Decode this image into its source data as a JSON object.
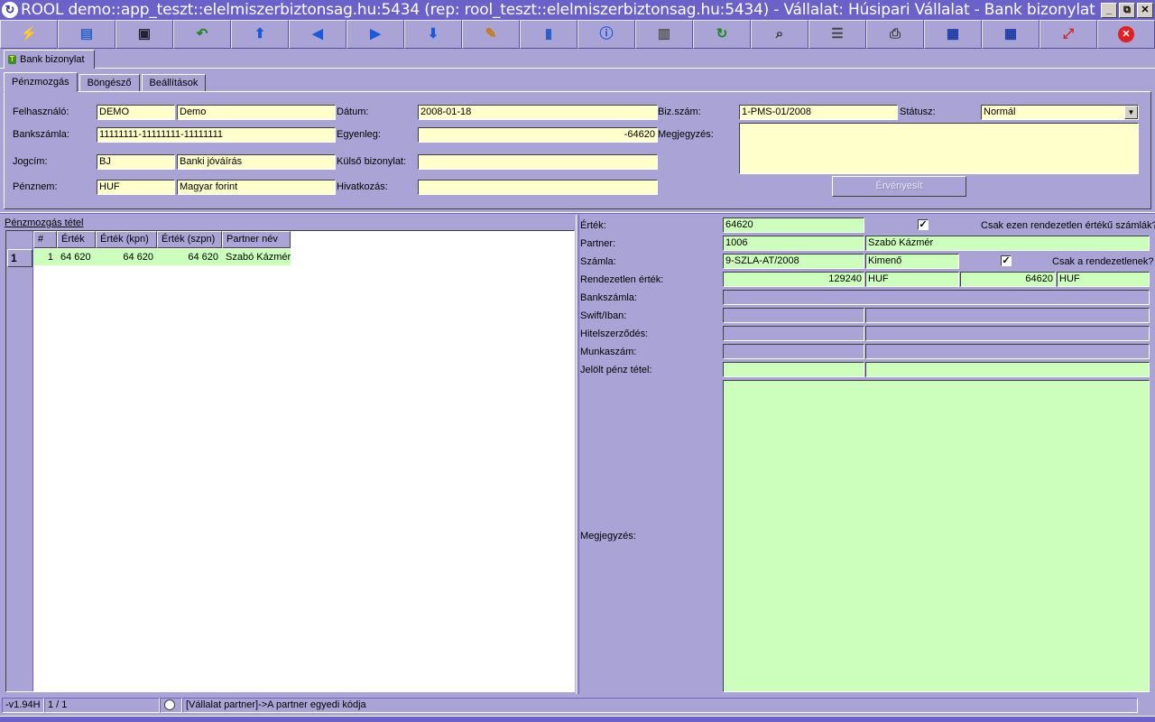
{
  "window": {
    "title": "ROOL demo::app_teszt::elelmiszerbiztonsag.hu:5434 (rep: rool_teszt::elelmiszerbiztonsag.hu:5434) - Vállalat: Húsipari Vállalat - Bank bizonylat",
    "minimize": "_",
    "restore": "⧉",
    "close": "✕"
  },
  "toolbar": {
    "icons": [
      "lightning-icon",
      "open-folder-icon",
      "save-icon",
      "undo-icon",
      "first-record-icon",
      "previous-record-icon",
      "next-record-icon",
      "last-record-icon",
      "edit-icon",
      "database-icon",
      "info-icon",
      "form-view-icon",
      "refresh-icon",
      "search-icon",
      "columns-icon",
      "print-icon",
      "grid-export-icon",
      "grid-import-icon",
      "resize-icon",
      "close-icon"
    ]
  },
  "doc_tab": {
    "label": "Bank bizonylat"
  },
  "subtabs": [
    {
      "label": "Pénzmozgás"
    },
    {
      "label": "Böngésző"
    },
    {
      "label": "Beállítások"
    }
  ],
  "form": {
    "felhasznalo_label": "Felhasználó:",
    "felhasznalo_code": "DEMO",
    "felhasznalo_name": "Demo",
    "bankszamla_label": "Bankszámla:",
    "bankszamla_value": "11111111-11111111-11111111",
    "jogcim_label": "Jogcím:",
    "jogcim_code": "BJ",
    "jogcim_name": "Banki jóváírás",
    "penznem_label": "Pénznem:",
    "penznem_code": "HUF",
    "penznem_name": "Magyar forint",
    "datum_label": "Dátum:",
    "datum_value": "2008-01-18",
    "egyenleg_label": "Egyenleg:",
    "egyenleg_value": "-64620",
    "kulso_label": "Külső bizonylat:",
    "kulso_value": "",
    "hivatkozas_label": "Hivatkozás:",
    "hivatkozas_value": "",
    "bizszam_label": "Biz.szám:",
    "bizszam_value": "1-PMS-01/2008",
    "statusz_label": "Státusz:",
    "statusz_value": "Normál",
    "megjegyzes_label": "Megjegyzés:",
    "megjegyzes_value": "",
    "ervenyesit_label": "Érvényesít"
  },
  "grid": {
    "title": "Pénzmozgás tétel",
    "columns": [
      "#",
      "Érték",
      "Érték (kpn)",
      "Érték (szpn)",
      "Partner név"
    ],
    "rows": [
      {
        "row_no": "1",
        "num": "1",
        "ertek": "64 620",
        "ertek_kpn": "64 620",
        "ertek_szpn": "64 620",
        "partner": "Szabó Kázmér"
      }
    ]
  },
  "detail": {
    "ertek_label": "Érték:",
    "ertek_value": "64620",
    "csak_rendezetlen_label": "Csak ezen rendezetlen értékű számlák?",
    "csak_rendezetlen_checked": "✓",
    "partner_label": "Partner:",
    "partner_code": "1006",
    "partner_name": "Szabó Kázmér",
    "szamla_label": "Számla:",
    "szamla_value": "9-SZLA-AT/2008",
    "szamla_type": "Kimenő",
    "csak_rendezetlenek_label": "Csak a rendezetlenek?",
    "csak_rendezetlenek_checked": "✓",
    "rendezetlen_label": "Rendezetlen érték:",
    "rendezetlen_value": "129240",
    "rendezetlen_ccy": "HUF",
    "rendezetlen_value2": "64620",
    "rendezetlen_ccy2": "HUF",
    "bankszamla_label": "Bankszámla:",
    "swift_label": "Swift/Iban:",
    "hitel_label": "Hitelszerződés:",
    "munkaszam_label": "Munkaszám:",
    "jelolt_label": "Jelölt pénz tétel:",
    "megjegyzes_label": "Megjegyzés:"
  },
  "status": {
    "version": "-v1.94H",
    "record": "1 / 1",
    "hint": "[Vállalat partner]->A partner egyedi kódja"
  }
}
